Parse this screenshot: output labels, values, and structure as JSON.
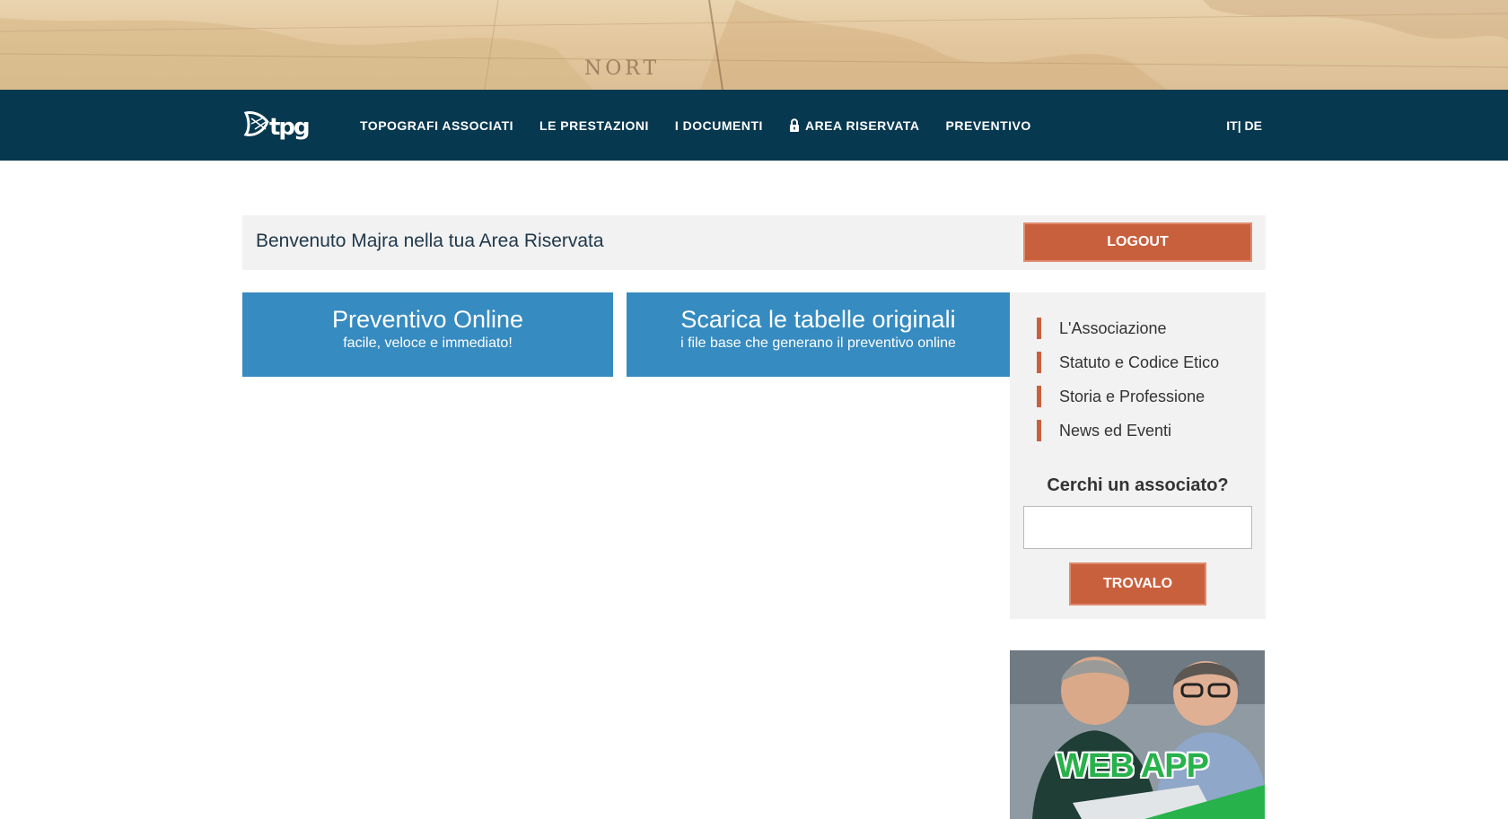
{
  "hero": {
    "map_label": "NORT"
  },
  "nav": {
    "logo_text": "tpg",
    "items": [
      {
        "label": "TOPOGRAFI ASSOCIATI"
      },
      {
        "label": "LE PRESTAZIONI"
      },
      {
        "label": "I DOCUMENTI"
      },
      {
        "label": "AREA RISERVATA",
        "icon": "lock-icon"
      },
      {
        "label": "PREVENTIVO"
      }
    ],
    "lang": "IT| DE"
  },
  "welcome": {
    "text": "Benvenuto Majra nella tua Area Riservata",
    "logout_label": "LOGOUT"
  },
  "cards": [
    {
      "title": "Preventivo Online",
      "subtitle": "facile, veloce e immediato!"
    },
    {
      "title": "Scarica le tabelle originali",
      "subtitle": "i file base che generano il preventivo online"
    }
  ],
  "sidebar": {
    "links": [
      {
        "label": "L'Associazione"
      },
      {
        "label": "Statuto e Codice Etico"
      },
      {
        "label": "Storia e Professione"
      },
      {
        "label": "News ed Eventi"
      }
    ],
    "search_title": "Cerchi un associato?",
    "search_value": "",
    "search_button": "TROVALO"
  },
  "banner": {
    "text": "WEB APP"
  },
  "colors": {
    "nav_bg": "#063850",
    "accent": "#c9603d",
    "card_blue": "#368bc0",
    "panel_gray": "#f2f2f2",
    "webapp_green": "#28b24b"
  }
}
